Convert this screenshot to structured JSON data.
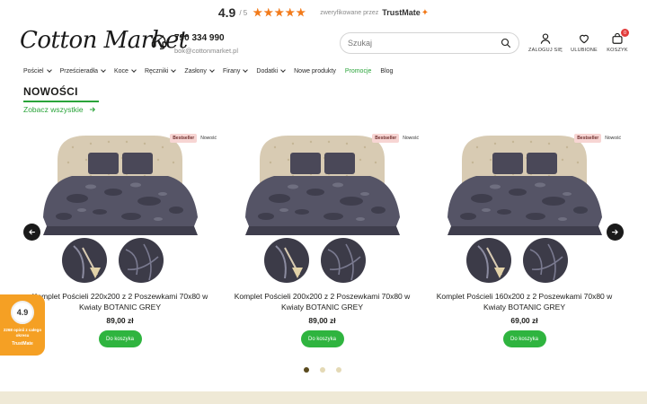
{
  "topbar": {
    "score": "4.9",
    "out_of": "/ 5",
    "verified_text": "zweryfikowane przez",
    "trustmate_brand": "TrustMate"
  },
  "header": {
    "logo_text": "Cotton Market",
    "phone": "790 334 990",
    "email": "bok@cottonmarket.pl",
    "search_placeholder": "Szukaj",
    "login_label": "ZALOGUJ SIĘ",
    "favorites_label": "ULUBIONE",
    "cart_label": "KOSZYK",
    "cart_count": "0"
  },
  "nav": {
    "items": [
      {
        "label": "Pościel",
        "has_dropdown": true
      },
      {
        "label": "Prześcieradła",
        "has_dropdown": true
      },
      {
        "label": "Koce",
        "has_dropdown": true
      },
      {
        "label": "Ręczniki",
        "has_dropdown": true
      },
      {
        "label": "Zasłony",
        "has_dropdown": true
      },
      {
        "label": "Firany",
        "has_dropdown": true
      },
      {
        "label": "Dodatki",
        "has_dropdown": true
      },
      {
        "label": "Nowe produkty",
        "has_dropdown": false
      },
      {
        "label": "Promocje",
        "has_dropdown": false
      },
      {
        "label": "Blog",
        "has_dropdown": false
      }
    ]
  },
  "section": {
    "title": "NOWOŚCI",
    "see_all": "Zobacz wszystkie"
  },
  "products": [
    {
      "name": "Komplet Pościeli 220x200 z 2 Poszewkami 70x80 w Kwiaty BOTANIC GREY",
      "price": "89,00 zł",
      "badge_bestseller": "Bestseller",
      "badge_new": "Nowość",
      "button": "Do koszyka"
    },
    {
      "name": "Komplet Pościeli 200x200 z 2 Poszewkami 70x80 w Kwiaty BOTANIC GREY",
      "price": "89,00 zł",
      "badge_bestseller": "Bestseller",
      "badge_new": "Nowość",
      "button": "Do koszyka"
    },
    {
      "name": "Komplet Pościeli 160x200 z 2 Poszewkami 70x80 w Kwiaty BOTANIC GREY",
      "price": "69,00 zł",
      "badge_bestseller": "Bestseller",
      "badge_new": "Nowość",
      "button": "Do koszyka"
    }
  ],
  "carousel": {
    "dots": 3,
    "active_dot": 0
  },
  "trustmate_widget": {
    "score": "4.9",
    "reviews_text": "2268 opinii z całego okresu",
    "brand": "TrustMate"
  },
  "colors": {
    "accent_green": "#2aa43a",
    "button_green": "#2fb43f",
    "trustmate_orange": "#f5a024",
    "footer_beige": "#efe9d6"
  }
}
